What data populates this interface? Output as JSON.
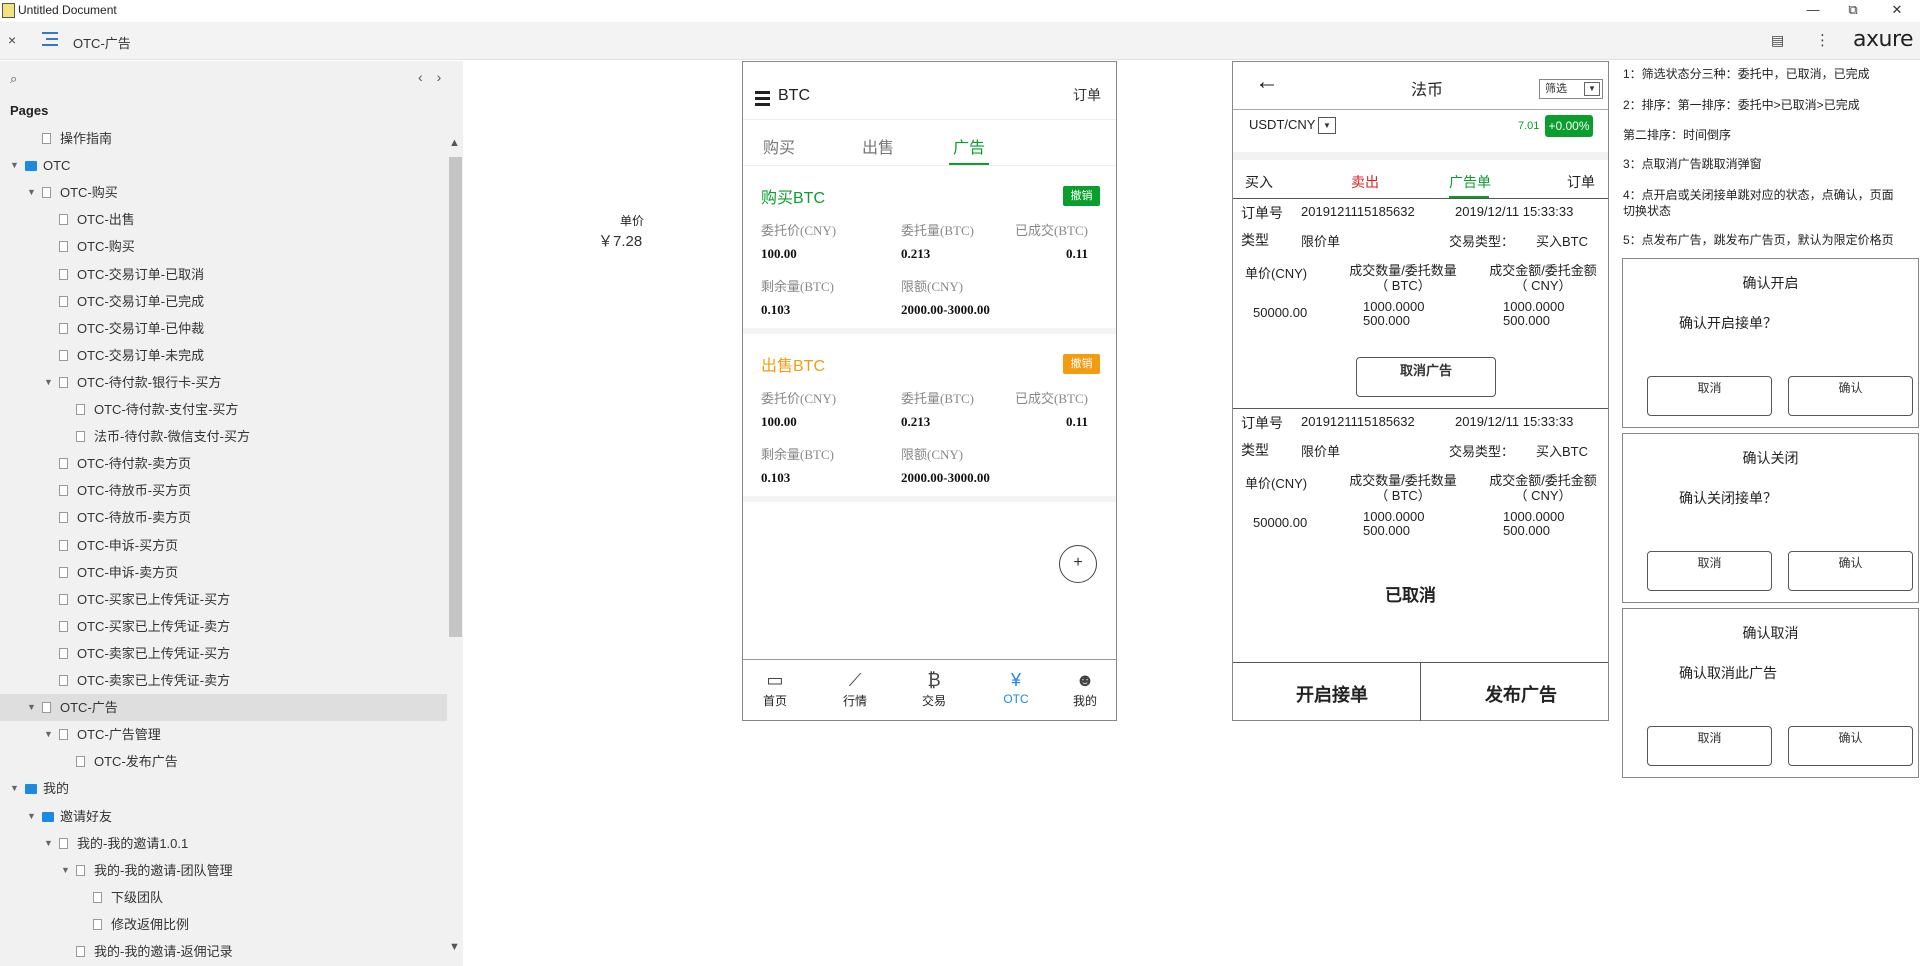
{
  "window": {
    "title": "Untitled Document",
    "minimize": "—",
    "restore": "⧉",
    "close": "✕"
  },
  "toolbar": {
    "close": "×",
    "page_name": "OTC-广告",
    "doc_icon": "▤",
    "more": "⋮",
    "brand": "axure"
  },
  "sidebar": {
    "search_icon": "⌕",
    "nav_arrows": "‹›",
    "pages_label": "Pages",
    "tree": [
      {
        "label": "操作指南",
        "level": 1,
        "kind": "page",
        "caret": ""
      },
      {
        "label": "OTC",
        "level": 0,
        "kind": "folder",
        "caret": "▼"
      },
      {
        "label": "OTC-购买",
        "level": 1,
        "kind": "page",
        "caret": "▼"
      },
      {
        "label": "OTC-出售",
        "level": 2,
        "kind": "page",
        "caret": ""
      },
      {
        "label": "OTC-购买",
        "level": 2,
        "kind": "page",
        "caret": ""
      },
      {
        "label": "OTC-交易订单-已取消",
        "level": 2,
        "kind": "page",
        "caret": ""
      },
      {
        "label": "OTC-交易订单-已完成",
        "level": 2,
        "kind": "page",
        "caret": ""
      },
      {
        "label": "OTC-交易订单-已仲裁",
        "level": 2,
        "kind": "page",
        "caret": ""
      },
      {
        "label": "OTC-交易订单-未完成",
        "level": 2,
        "kind": "page",
        "caret": ""
      },
      {
        "label": "OTC-待付款-银行卡-买方",
        "level": 2,
        "kind": "page",
        "caret": "▼"
      },
      {
        "label": "OTC-待付款-支付宝-买方",
        "level": 3,
        "kind": "page",
        "caret": ""
      },
      {
        "label": "法币-待付款-微信支付-买方",
        "level": 3,
        "kind": "page",
        "caret": ""
      },
      {
        "label": "OTC-待付款-卖方页",
        "level": 2,
        "kind": "page",
        "caret": ""
      },
      {
        "label": "OTC-待放币-买方页",
        "level": 2,
        "kind": "page",
        "caret": ""
      },
      {
        "label": "OTC-待放币-卖方页",
        "level": 2,
        "kind": "page",
        "caret": ""
      },
      {
        "label": "OTC-申诉-买方页",
        "level": 2,
        "kind": "page",
        "caret": ""
      },
      {
        "label": "OTC-申诉-卖方页",
        "level": 2,
        "kind": "page",
        "caret": ""
      },
      {
        "label": "OTC-买家已上传凭证-买方",
        "level": 2,
        "kind": "page",
        "caret": ""
      },
      {
        "label": "OTC-买家已上传凭证-卖方",
        "level": 2,
        "kind": "page",
        "caret": ""
      },
      {
        "label": "OTC-卖家已上传凭证-买方",
        "level": 2,
        "kind": "page",
        "caret": ""
      },
      {
        "label": "OTC-卖家已上传凭证-卖方",
        "level": 2,
        "kind": "page",
        "caret": ""
      },
      {
        "label": "OTC-广告",
        "level": 1,
        "kind": "page",
        "caret": "▼",
        "selected": true
      },
      {
        "label": "OTC-广告管理",
        "level": 2,
        "kind": "page",
        "caret": "▼"
      },
      {
        "label": "OTC-发布广告",
        "level": 3,
        "kind": "page",
        "caret": ""
      },
      {
        "label": "我的",
        "level": 0,
        "kind": "folder",
        "caret": "▼"
      },
      {
        "label": "邀请好友",
        "level": 1,
        "kind": "folder",
        "caret": "▼"
      },
      {
        "label": "我的-我的邀请1.0.1",
        "level": 2,
        "kind": "page",
        "caret": "▼"
      },
      {
        "label": "我的-我的邀请-团队管理",
        "level": 3,
        "kind": "page",
        "caret": "▼"
      },
      {
        "label": "下级团队",
        "level": 4,
        "kind": "page",
        "caret": ""
      },
      {
        "label": "修改返佣比例",
        "level": 4,
        "kind": "page",
        "caret": ""
      },
      {
        "label": "我的-我的邀请-返佣记录",
        "level": 3,
        "kind": "page",
        "caret": ""
      }
    ],
    "scroll_up": "▲",
    "scroll_down": "▼"
  },
  "canvas": {
    "price_label": "单价",
    "price_value": "￥7.28"
  },
  "phone1": {
    "title": "BTC",
    "order_link": "订单",
    "tabs": [
      "购买",
      "出售",
      "广告"
    ],
    "cards": [
      {
        "title": "购买BTC",
        "title_color": "#0a9e2d",
        "badge": "撤销",
        "badge_color": "#0a9e2d",
        "k1": "委托价(CNY)",
        "k2": "委托量(BTC)",
        "k3": "已成交(BTC)",
        "v1": "100.00",
        "v2": "0.213",
        "v3": "0.11",
        "k4": "剩余量(BTC)",
        "k5": "限额(CNY)",
        "v4": "0.103",
        "v5": "2000.00-3000.00"
      },
      {
        "title": "出售BTC",
        "title_color": "#f39c12",
        "badge": "撤销",
        "badge_color": "#f39c12",
        "k1": "委托价(CNY)",
        "k2": "委托量(BTC)",
        "k3": "已成交(BTC)",
        "v1": "100.00",
        "v2": "0.213",
        "v3": "0.11",
        "k4": "剩余量(BTC)",
        "k5": "限额(CNY)",
        "v4": "0.103",
        "v5": "2000.00-3000.00"
      }
    ],
    "fab": "+",
    "nav": [
      {
        "label": "首页",
        "icon": "monitor-icon",
        "glyph": "▭"
      },
      {
        "label": "行情",
        "icon": "chart-icon",
        "glyph": "⟋"
      },
      {
        "label": "交易",
        "icon": "bitcoin-icon",
        "glyph": "₿"
      },
      {
        "label": "OTC",
        "icon": "yuan-icon",
        "glyph": "¥"
      },
      {
        "label": "我的",
        "icon": "user-icon",
        "glyph": "☻"
      }
    ]
  },
  "phone2": {
    "back": "←",
    "title": "法币",
    "filter": "筛选",
    "pair": "USDT/CNY",
    "price": "7.01",
    "change": "+0.00%",
    "tabs": [
      "买入",
      "卖出",
      "广告单",
      "订单"
    ],
    "orders": [
      {
        "no_label": "订单号",
        "no": "2019121115185632",
        "time": "2019/12/11 15:33:33",
        "type_label": "类型",
        "type": "限价单",
        "trade_label": "交易类型：",
        "trade": "买入BTC",
        "h1": "单价(CNY)",
        "h2a": "成交数量/委托数量",
        "h2b": "（ BTC）",
        "h3a": "成交金额/委托金额",
        "h3b": "（ CNY）",
        "price": "50000.00",
        "q1": "1000.0000",
        "q2": "500.000",
        "a1": "1000.0000",
        "a2": "500.000",
        "action": "取消广告"
      },
      {
        "no_label": "订单号",
        "no": "2019121115185632",
        "time": "2019/12/11 15:33:33",
        "type_label": "类型",
        "type": "限价单",
        "trade_label": "交易类型：",
        "trade": "买入BTC",
        "h1": "单价(CNY)",
        "h2a": "成交数量/委托数量",
        "h2b": "（ BTC）",
        "h3a": "成交金额/委托金额",
        "h3b": "（ CNY）",
        "price": "50000.00",
        "q1": "1000.0000",
        "q2": "500.000",
        "a1": "1000.0000",
        "a2": "500.000",
        "status": "已取消"
      }
    ],
    "bottom_left": "开启接单",
    "bottom_right": "发布广告"
  },
  "notes": [
    "1：筛选状态分三种：委托中，已取消，已完成",
    "2：排序：第一排序：委托中>已取消>已完成",
    "第二排序：时间倒序",
    "3：点取消广告跳取消弹窗",
    "4：点开启或关闭接单跳对应的状态，点确认，页面",
    "切换状态",
    "5：点发布广告，跳发布广告页，默认为限定价格页"
  ],
  "dialogs": [
    {
      "title": "确认开启",
      "message": "确认开启接单？",
      "cancel": "取消",
      "confirm": "确认"
    },
    {
      "title": "确认关闭",
      "message": "确认关闭接单？",
      "cancel": "取消",
      "confirm": "确认"
    },
    {
      "title": "确认取消",
      "message": "确认取消此广告",
      "cancel": "取消",
      "confirm": "确认"
    }
  ]
}
